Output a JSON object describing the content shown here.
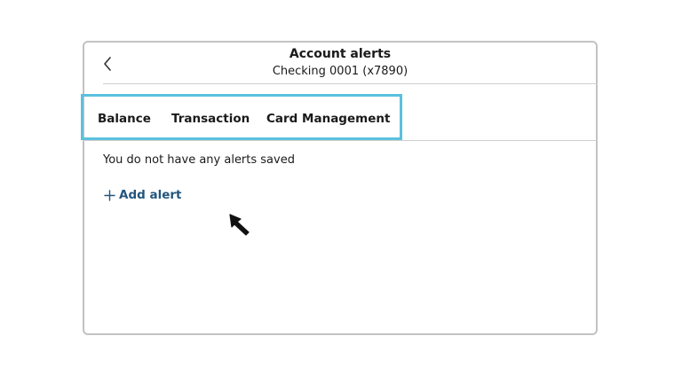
{
  "header": {
    "title": "Account alerts",
    "subtitle": "Checking 0001 (x7890)"
  },
  "tabs": [
    {
      "label": "Balance",
      "active": true
    },
    {
      "label": "Transaction",
      "active": false
    },
    {
      "label": "Card Management",
      "active": false
    }
  ],
  "content": {
    "empty_message": "You do not have any alerts saved",
    "add_alert_label": "Add alert"
  },
  "colors": {
    "accent": "#24557c",
    "highlight": "#5bc0de",
    "border": "#c2c2c2"
  },
  "icons": {
    "back": "chevron-left-icon",
    "add": "plus-icon",
    "cursor": "mouse-pointer-icon"
  }
}
